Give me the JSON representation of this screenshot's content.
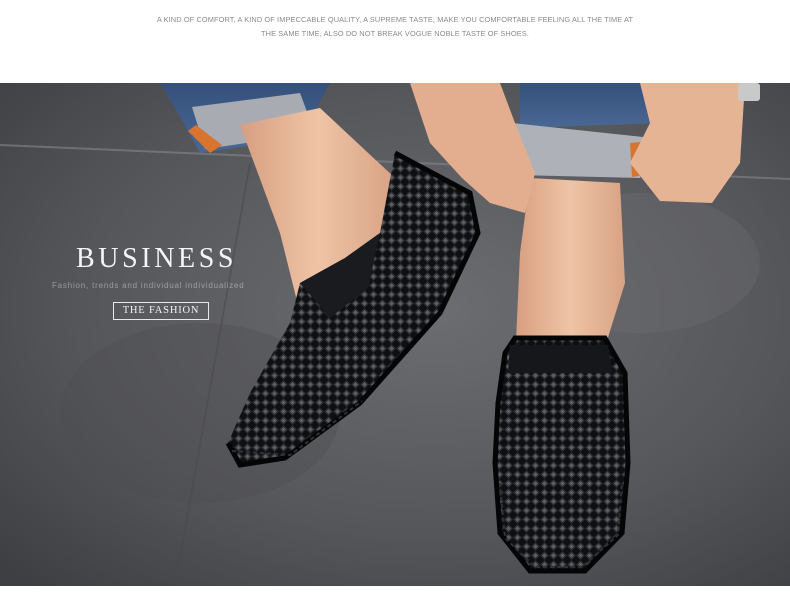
{
  "banner": {
    "tagline": "A KIND OF COMFORT, A KIND OF IMPECCABLE QUALITY, A SUPREME TASTE, MAKE YOU COMFORTABLE FEELING ALL THE TIME AT THE SAME TIME, ALSO DO NOT BREAK VOGUE NOBLE TASTE OF SHOES."
  },
  "hero": {
    "headline": "BUSINESS",
    "subline": "Fashion, trends and individual individualized",
    "tag": "THE FASHION"
  },
  "colors": {
    "floor": "#5a5b5d",
    "shoe": "#111214",
    "denim": "#3d5a87",
    "skin": "#e9b99a",
    "accent_orange": "#d9742e"
  }
}
